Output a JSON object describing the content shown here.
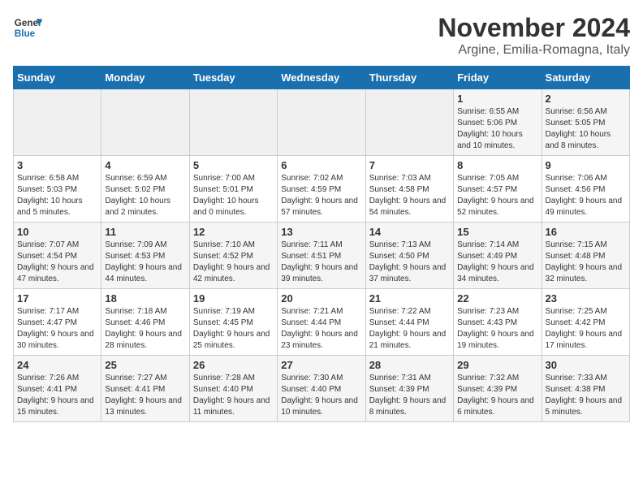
{
  "header": {
    "logo_line1": "General",
    "logo_line2": "Blue",
    "month": "November 2024",
    "location": "Argine, Emilia-Romagna, Italy"
  },
  "days_of_week": [
    "Sunday",
    "Monday",
    "Tuesday",
    "Wednesday",
    "Thursday",
    "Friday",
    "Saturday"
  ],
  "weeks": [
    [
      {
        "day": "",
        "info": ""
      },
      {
        "day": "",
        "info": ""
      },
      {
        "day": "",
        "info": ""
      },
      {
        "day": "",
        "info": ""
      },
      {
        "day": "",
        "info": ""
      },
      {
        "day": "1",
        "info": "Sunrise: 6:55 AM\nSunset: 5:06 PM\nDaylight: 10 hours and 10 minutes."
      },
      {
        "day": "2",
        "info": "Sunrise: 6:56 AM\nSunset: 5:05 PM\nDaylight: 10 hours and 8 minutes."
      }
    ],
    [
      {
        "day": "3",
        "info": "Sunrise: 6:58 AM\nSunset: 5:03 PM\nDaylight: 10 hours and 5 minutes."
      },
      {
        "day": "4",
        "info": "Sunrise: 6:59 AM\nSunset: 5:02 PM\nDaylight: 10 hours and 2 minutes."
      },
      {
        "day": "5",
        "info": "Sunrise: 7:00 AM\nSunset: 5:01 PM\nDaylight: 10 hours and 0 minutes."
      },
      {
        "day": "6",
        "info": "Sunrise: 7:02 AM\nSunset: 4:59 PM\nDaylight: 9 hours and 57 minutes."
      },
      {
        "day": "7",
        "info": "Sunrise: 7:03 AM\nSunset: 4:58 PM\nDaylight: 9 hours and 54 minutes."
      },
      {
        "day": "8",
        "info": "Sunrise: 7:05 AM\nSunset: 4:57 PM\nDaylight: 9 hours and 52 minutes."
      },
      {
        "day": "9",
        "info": "Sunrise: 7:06 AM\nSunset: 4:56 PM\nDaylight: 9 hours and 49 minutes."
      }
    ],
    [
      {
        "day": "10",
        "info": "Sunrise: 7:07 AM\nSunset: 4:54 PM\nDaylight: 9 hours and 47 minutes."
      },
      {
        "day": "11",
        "info": "Sunrise: 7:09 AM\nSunset: 4:53 PM\nDaylight: 9 hours and 44 minutes."
      },
      {
        "day": "12",
        "info": "Sunrise: 7:10 AM\nSunset: 4:52 PM\nDaylight: 9 hours and 42 minutes."
      },
      {
        "day": "13",
        "info": "Sunrise: 7:11 AM\nSunset: 4:51 PM\nDaylight: 9 hours and 39 minutes."
      },
      {
        "day": "14",
        "info": "Sunrise: 7:13 AM\nSunset: 4:50 PM\nDaylight: 9 hours and 37 minutes."
      },
      {
        "day": "15",
        "info": "Sunrise: 7:14 AM\nSunset: 4:49 PM\nDaylight: 9 hours and 34 minutes."
      },
      {
        "day": "16",
        "info": "Sunrise: 7:15 AM\nSunset: 4:48 PM\nDaylight: 9 hours and 32 minutes."
      }
    ],
    [
      {
        "day": "17",
        "info": "Sunrise: 7:17 AM\nSunset: 4:47 PM\nDaylight: 9 hours and 30 minutes."
      },
      {
        "day": "18",
        "info": "Sunrise: 7:18 AM\nSunset: 4:46 PM\nDaylight: 9 hours and 28 minutes."
      },
      {
        "day": "19",
        "info": "Sunrise: 7:19 AM\nSunset: 4:45 PM\nDaylight: 9 hours and 25 minutes."
      },
      {
        "day": "20",
        "info": "Sunrise: 7:21 AM\nSunset: 4:44 PM\nDaylight: 9 hours and 23 minutes."
      },
      {
        "day": "21",
        "info": "Sunrise: 7:22 AM\nSunset: 4:44 PM\nDaylight: 9 hours and 21 minutes."
      },
      {
        "day": "22",
        "info": "Sunrise: 7:23 AM\nSunset: 4:43 PM\nDaylight: 9 hours and 19 minutes."
      },
      {
        "day": "23",
        "info": "Sunrise: 7:25 AM\nSunset: 4:42 PM\nDaylight: 9 hours and 17 minutes."
      }
    ],
    [
      {
        "day": "24",
        "info": "Sunrise: 7:26 AM\nSunset: 4:41 PM\nDaylight: 9 hours and 15 minutes."
      },
      {
        "day": "25",
        "info": "Sunrise: 7:27 AM\nSunset: 4:41 PM\nDaylight: 9 hours and 13 minutes."
      },
      {
        "day": "26",
        "info": "Sunrise: 7:28 AM\nSunset: 4:40 PM\nDaylight: 9 hours and 11 minutes."
      },
      {
        "day": "27",
        "info": "Sunrise: 7:30 AM\nSunset: 4:40 PM\nDaylight: 9 hours and 10 minutes."
      },
      {
        "day": "28",
        "info": "Sunrise: 7:31 AM\nSunset: 4:39 PM\nDaylight: 9 hours and 8 minutes."
      },
      {
        "day": "29",
        "info": "Sunrise: 7:32 AM\nSunset: 4:39 PM\nDaylight: 9 hours and 6 minutes."
      },
      {
        "day": "30",
        "info": "Sunrise: 7:33 AM\nSunset: 4:38 PM\nDaylight: 9 hours and 5 minutes."
      }
    ]
  ]
}
